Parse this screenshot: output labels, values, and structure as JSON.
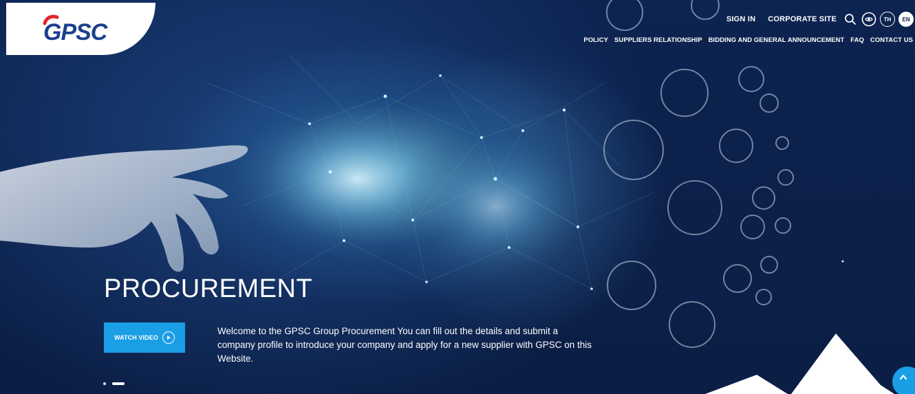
{
  "brand": {
    "logo_text": "GPSC",
    "colors": {
      "navy": "#0c1f47",
      "accent_blue": "#1a9ee6",
      "logo_red": "#e3262c",
      "logo_blue": "#1b3f8f"
    }
  },
  "header": {
    "utility": {
      "sign_in": "SIGN IN",
      "corporate_site": "CORPORATE SITE",
      "icons": [
        "search-icon",
        "accessibility-icon"
      ],
      "languages": [
        {
          "code": "TH",
          "active": false
        },
        {
          "code": "EN",
          "active": true
        }
      ]
    },
    "nav": [
      "POLICY",
      "SUPPLIERS RELATIONSHIP",
      "BIDDING AND GENERAL ANNOUNCEMENT",
      "FAQ",
      "CONTACT US"
    ]
  },
  "hero": {
    "title": "PROCUREMENT",
    "watch_button": "WATCH VIDEO",
    "description": "Welcome to the GPSC Group Procurement You can fill out the details and submit a company profile to introduce your company and apply for a new supplier with GPSC on this Website.",
    "slides": {
      "count": 2,
      "active": 2
    }
  },
  "floating": {
    "scroll_top_icon": "arrow-up-icon"
  }
}
